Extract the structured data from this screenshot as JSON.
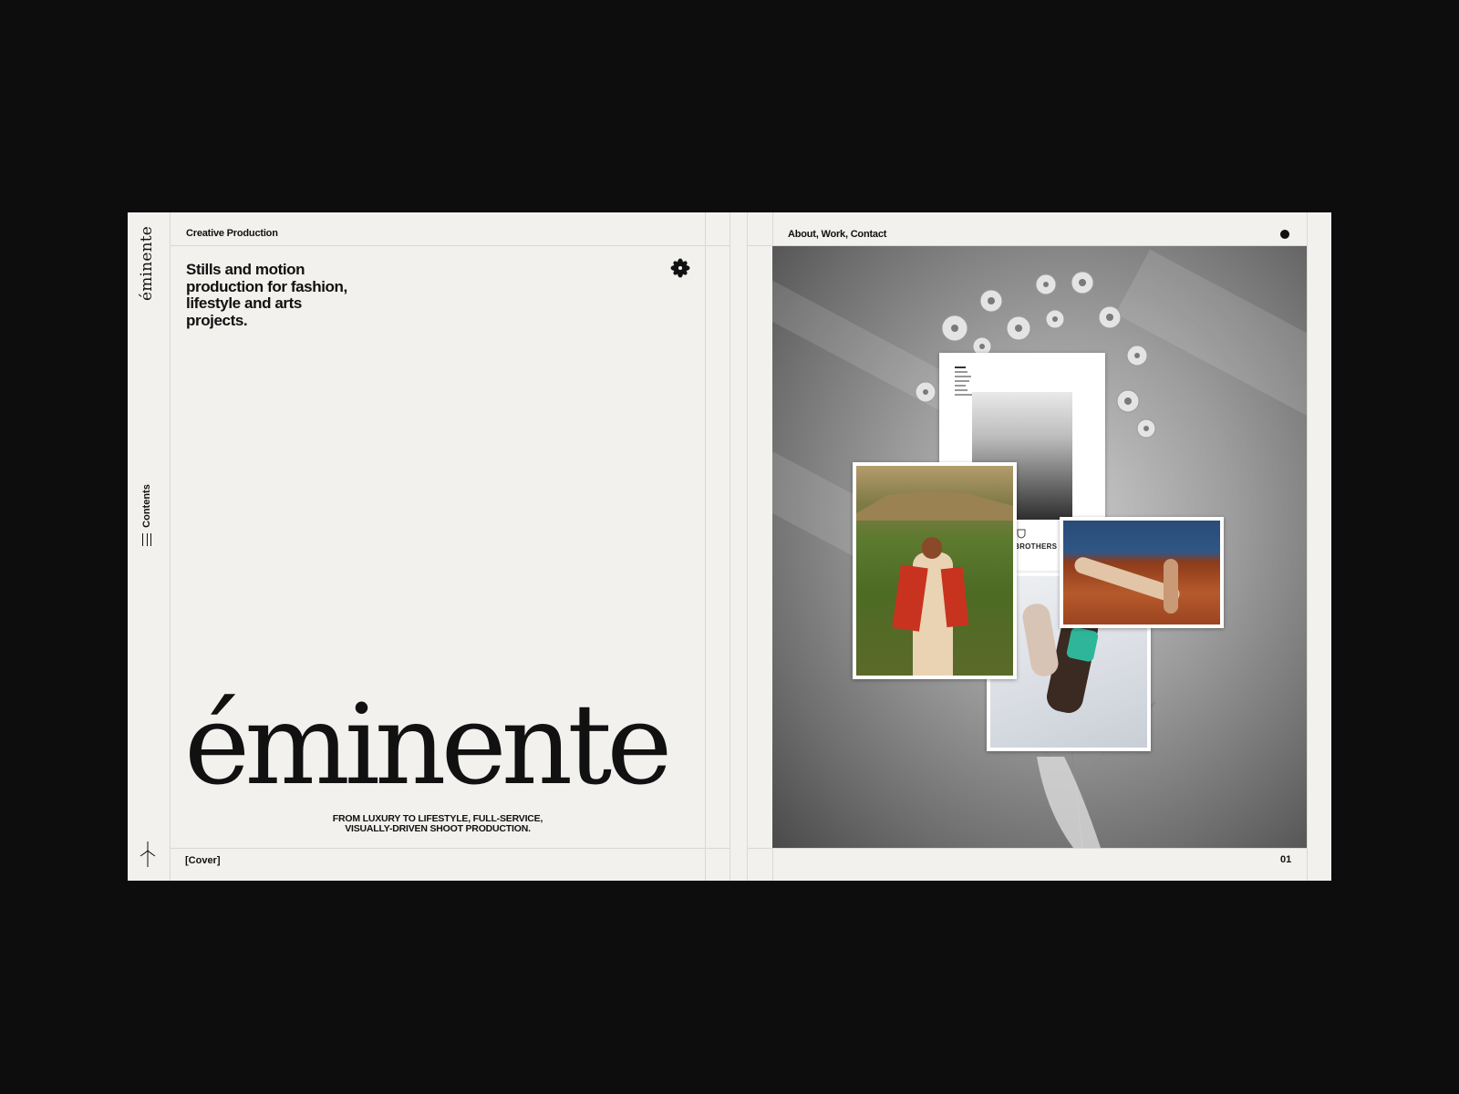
{
  "brand": {
    "logo_vertical": "éminente",
    "wordmark": "éminente"
  },
  "left_page": {
    "header_label": "Creative Production",
    "tagline": "Stills and motion production for fashion, lifestyle and arts projects.",
    "subtitle_line1": "FROM LUXURY TO LIFESTYLE, FULL-SERVICE,",
    "subtitle_line2": "VISUALLY-DRIVEN SHOOT PRODUCTION.",
    "footer_label": "[Cover]"
  },
  "sidebar": {
    "contents_label": "Contents",
    "icons": [
      "menu-icon",
      "flourish-icon"
    ]
  },
  "right_page": {
    "nav_label": "About, Work, Contact",
    "page_number": "01",
    "brothers_label": "BROTHERS"
  },
  "colors": {
    "background": "#0d0d0d",
    "paper": "#f2f1ee",
    "ink": "#111111",
    "rule": "#d9d8d4"
  }
}
